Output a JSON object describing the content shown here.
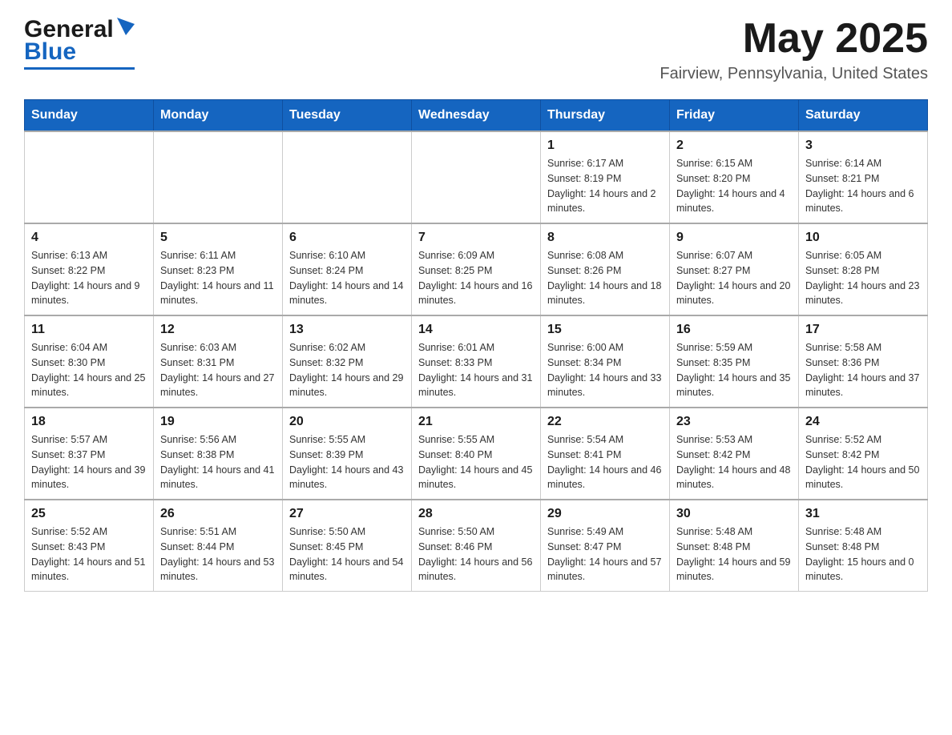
{
  "header": {
    "logo": {
      "text_general": "General",
      "text_blue": "Blue",
      "alt": "GeneralBlue logo"
    },
    "title": "May 2025",
    "location": "Fairview, Pennsylvania, United States"
  },
  "calendar": {
    "days_of_week": [
      "Sunday",
      "Monday",
      "Tuesday",
      "Wednesday",
      "Thursday",
      "Friday",
      "Saturday"
    ],
    "weeks": [
      [
        {
          "day": "",
          "info": ""
        },
        {
          "day": "",
          "info": ""
        },
        {
          "day": "",
          "info": ""
        },
        {
          "day": "",
          "info": ""
        },
        {
          "day": "1",
          "info": "Sunrise: 6:17 AM\nSunset: 8:19 PM\nDaylight: 14 hours and 2 minutes."
        },
        {
          "day": "2",
          "info": "Sunrise: 6:15 AM\nSunset: 8:20 PM\nDaylight: 14 hours and 4 minutes."
        },
        {
          "day": "3",
          "info": "Sunrise: 6:14 AM\nSunset: 8:21 PM\nDaylight: 14 hours and 6 minutes."
        }
      ],
      [
        {
          "day": "4",
          "info": "Sunrise: 6:13 AM\nSunset: 8:22 PM\nDaylight: 14 hours and 9 minutes."
        },
        {
          "day": "5",
          "info": "Sunrise: 6:11 AM\nSunset: 8:23 PM\nDaylight: 14 hours and 11 minutes."
        },
        {
          "day": "6",
          "info": "Sunrise: 6:10 AM\nSunset: 8:24 PM\nDaylight: 14 hours and 14 minutes."
        },
        {
          "day": "7",
          "info": "Sunrise: 6:09 AM\nSunset: 8:25 PM\nDaylight: 14 hours and 16 minutes."
        },
        {
          "day": "8",
          "info": "Sunrise: 6:08 AM\nSunset: 8:26 PM\nDaylight: 14 hours and 18 minutes."
        },
        {
          "day": "9",
          "info": "Sunrise: 6:07 AM\nSunset: 8:27 PM\nDaylight: 14 hours and 20 minutes."
        },
        {
          "day": "10",
          "info": "Sunrise: 6:05 AM\nSunset: 8:28 PM\nDaylight: 14 hours and 23 minutes."
        }
      ],
      [
        {
          "day": "11",
          "info": "Sunrise: 6:04 AM\nSunset: 8:30 PM\nDaylight: 14 hours and 25 minutes."
        },
        {
          "day": "12",
          "info": "Sunrise: 6:03 AM\nSunset: 8:31 PM\nDaylight: 14 hours and 27 minutes."
        },
        {
          "day": "13",
          "info": "Sunrise: 6:02 AM\nSunset: 8:32 PM\nDaylight: 14 hours and 29 minutes."
        },
        {
          "day": "14",
          "info": "Sunrise: 6:01 AM\nSunset: 8:33 PM\nDaylight: 14 hours and 31 minutes."
        },
        {
          "day": "15",
          "info": "Sunrise: 6:00 AM\nSunset: 8:34 PM\nDaylight: 14 hours and 33 minutes."
        },
        {
          "day": "16",
          "info": "Sunrise: 5:59 AM\nSunset: 8:35 PM\nDaylight: 14 hours and 35 minutes."
        },
        {
          "day": "17",
          "info": "Sunrise: 5:58 AM\nSunset: 8:36 PM\nDaylight: 14 hours and 37 minutes."
        }
      ],
      [
        {
          "day": "18",
          "info": "Sunrise: 5:57 AM\nSunset: 8:37 PM\nDaylight: 14 hours and 39 minutes."
        },
        {
          "day": "19",
          "info": "Sunrise: 5:56 AM\nSunset: 8:38 PM\nDaylight: 14 hours and 41 minutes."
        },
        {
          "day": "20",
          "info": "Sunrise: 5:55 AM\nSunset: 8:39 PM\nDaylight: 14 hours and 43 minutes."
        },
        {
          "day": "21",
          "info": "Sunrise: 5:55 AM\nSunset: 8:40 PM\nDaylight: 14 hours and 45 minutes."
        },
        {
          "day": "22",
          "info": "Sunrise: 5:54 AM\nSunset: 8:41 PM\nDaylight: 14 hours and 46 minutes."
        },
        {
          "day": "23",
          "info": "Sunrise: 5:53 AM\nSunset: 8:42 PM\nDaylight: 14 hours and 48 minutes."
        },
        {
          "day": "24",
          "info": "Sunrise: 5:52 AM\nSunset: 8:42 PM\nDaylight: 14 hours and 50 minutes."
        }
      ],
      [
        {
          "day": "25",
          "info": "Sunrise: 5:52 AM\nSunset: 8:43 PM\nDaylight: 14 hours and 51 minutes."
        },
        {
          "day": "26",
          "info": "Sunrise: 5:51 AM\nSunset: 8:44 PM\nDaylight: 14 hours and 53 minutes."
        },
        {
          "day": "27",
          "info": "Sunrise: 5:50 AM\nSunset: 8:45 PM\nDaylight: 14 hours and 54 minutes."
        },
        {
          "day": "28",
          "info": "Sunrise: 5:50 AM\nSunset: 8:46 PM\nDaylight: 14 hours and 56 minutes."
        },
        {
          "day": "29",
          "info": "Sunrise: 5:49 AM\nSunset: 8:47 PM\nDaylight: 14 hours and 57 minutes."
        },
        {
          "day": "30",
          "info": "Sunrise: 5:48 AM\nSunset: 8:48 PM\nDaylight: 14 hours and 59 minutes."
        },
        {
          "day": "31",
          "info": "Sunrise: 5:48 AM\nSunset: 8:48 PM\nDaylight: 15 hours and 0 minutes."
        }
      ]
    ]
  }
}
